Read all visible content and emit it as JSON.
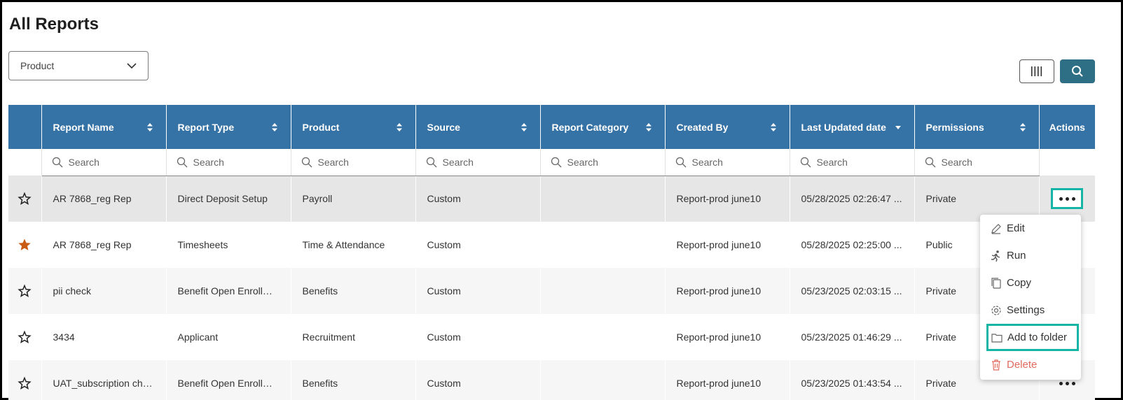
{
  "page": {
    "title": "All Reports"
  },
  "filter": {
    "product_label": "Product"
  },
  "table": {
    "columns": [
      {
        "label": "Report Name",
        "sort": "both"
      },
      {
        "label": "Report Type",
        "sort": "both"
      },
      {
        "label": "Product",
        "sort": "both"
      },
      {
        "label": "Source",
        "sort": "both"
      },
      {
        "label": "Report Category",
        "sort": "both"
      },
      {
        "label": "Created By",
        "sort": "both"
      },
      {
        "label": "Last Updated date",
        "sort": "desc"
      },
      {
        "label": "Permissions",
        "sort": "both"
      },
      {
        "label": "Actions",
        "sort": "none"
      }
    ],
    "search_placeholder": "Search",
    "rows": [
      {
        "favorite": false,
        "name": "AR 7868_reg Rep",
        "type": "Direct Deposit Setup",
        "product": "Payroll",
        "source": "Custom",
        "category": "",
        "created_by": "Report-prod june10",
        "updated": "05/28/2025 02:26:47 ...",
        "permissions": "Private"
      },
      {
        "favorite": true,
        "name": "AR 7868_reg Rep",
        "type": "Timesheets",
        "product": "Time & Attendance",
        "source": "Custom",
        "category": "",
        "created_by": "Report-prod june10",
        "updated": "05/28/2025 02:25:00 ...",
        "permissions": "Public"
      },
      {
        "favorite": false,
        "name": "pii check",
        "type": "Benefit Open Enrollme...",
        "product": "Benefits",
        "source": "Custom",
        "category": "",
        "created_by": "Report-prod june10",
        "updated": "05/23/2025 02:03:15 ...",
        "permissions": "Private"
      },
      {
        "favorite": false,
        "name": "3434",
        "type": "Applicant",
        "product": "Recruitment",
        "source": "Custom",
        "category": "",
        "created_by": "Report-prod june10",
        "updated": "05/23/2025 01:46:29 ...",
        "permissions": "Private"
      },
      {
        "favorite": false,
        "name": "UAT_subscription check",
        "type": "Benefit Open Enrollme...",
        "product": "Benefits",
        "source": "Custom",
        "category": "",
        "created_by": "Report-prod june10",
        "updated": "05/23/2025 01:43:54 ...",
        "permissions": "Private"
      }
    ]
  },
  "menu": {
    "edit": "Edit",
    "run": "Run",
    "copy": "Copy",
    "settings": "Settings",
    "add_to_folder": "Add to folder",
    "delete": "Delete"
  },
  "colors": {
    "header": "#3572a5",
    "search_button": "#2f6f85",
    "highlight": "#15b5a5",
    "favorite_star": "#c85a14",
    "delete": "#e06a5d"
  }
}
